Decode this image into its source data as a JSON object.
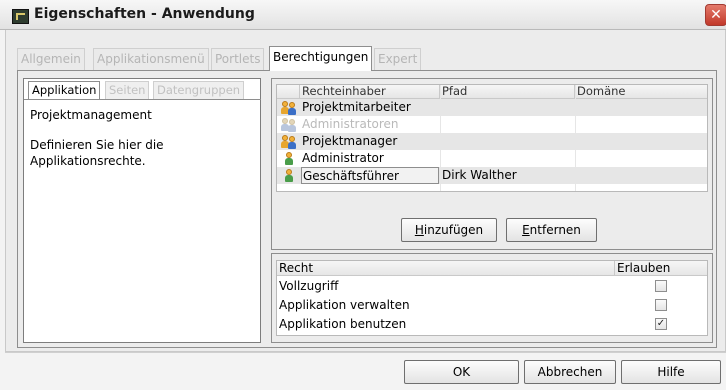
{
  "window": {
    "title": "Eigenschaften - Anwendung",
    "close_icon": "close-icon"
  },
  "tabs": [
    {
      "label": "Allgemein"
    },
    {
      "label": "Applikationsmenü"
    },
    {
      "label": "Portlets"
    },
    {
      "label": "Berechtigungen"
    },
    {
      "label": "Expert"
    }
  ],
  "subtabs": [
    {
      "label": "Applikation"
    },
    {
      "label": "Seiten"
    },
    {
      "label": "Datengruppen"
    }
  ],
  "application": {
    "name": "Projektmanagement",
    "description": "Definieren Sie hier die Applikationsrechte."
  },
  "owners": {
    "columns": [
      "Rechteinhaber",
      "Pfad",
      "Domäne"
    ],
    "rows": [
      {
        "name": "Projektmitarbeiter",
        "path": "",
        "domain": "",
        "icon": "group-icon",
        "disabled": false
      },
      {
        "name": "Administratoren",
        "path": "",
        "domain": "",
        "icon": "group-icon",
        "disabled": true
      },
      {
        "name": "Projektmanager",
        "path": "",
        "domain": "",
        "icon": "group-icon",
        "disabled": false
      },
      {
        "name": "Administrator",
        "path": "",
        "domain": "",
        "icon": "user-icon",
        "disabled": false
      },
      {
        "name": "Geschäftsführer",
        "path": "Dirk Walther",
        "domain": "",
        "icon": "user-icon",
        "disabled": false
      }
    ]
  },
  "buttons": {
    "add": {
      "mnemonic": "H",
      "rest": "inzufügen"
    },
    "remove": {
      "mnemonic": "E",
      "rest": "ntfernen"
    },
    "ok": "OK",
    "cancel": "Abbrechen",
    "help": "Hilfe"
  },
  "rights": {
    "columns": [
      "Recht",
      "Erlauben"
    ],
    "rows": [
      {
        "label": "Vollzugriff",
        "allowed": false
      },
      {
        "label": "Applikation verwalten",
        "allowed": false
      },
      {
        "label": "Applikation benutzen",
        "allowed": true
      }
    ]
  }
}
